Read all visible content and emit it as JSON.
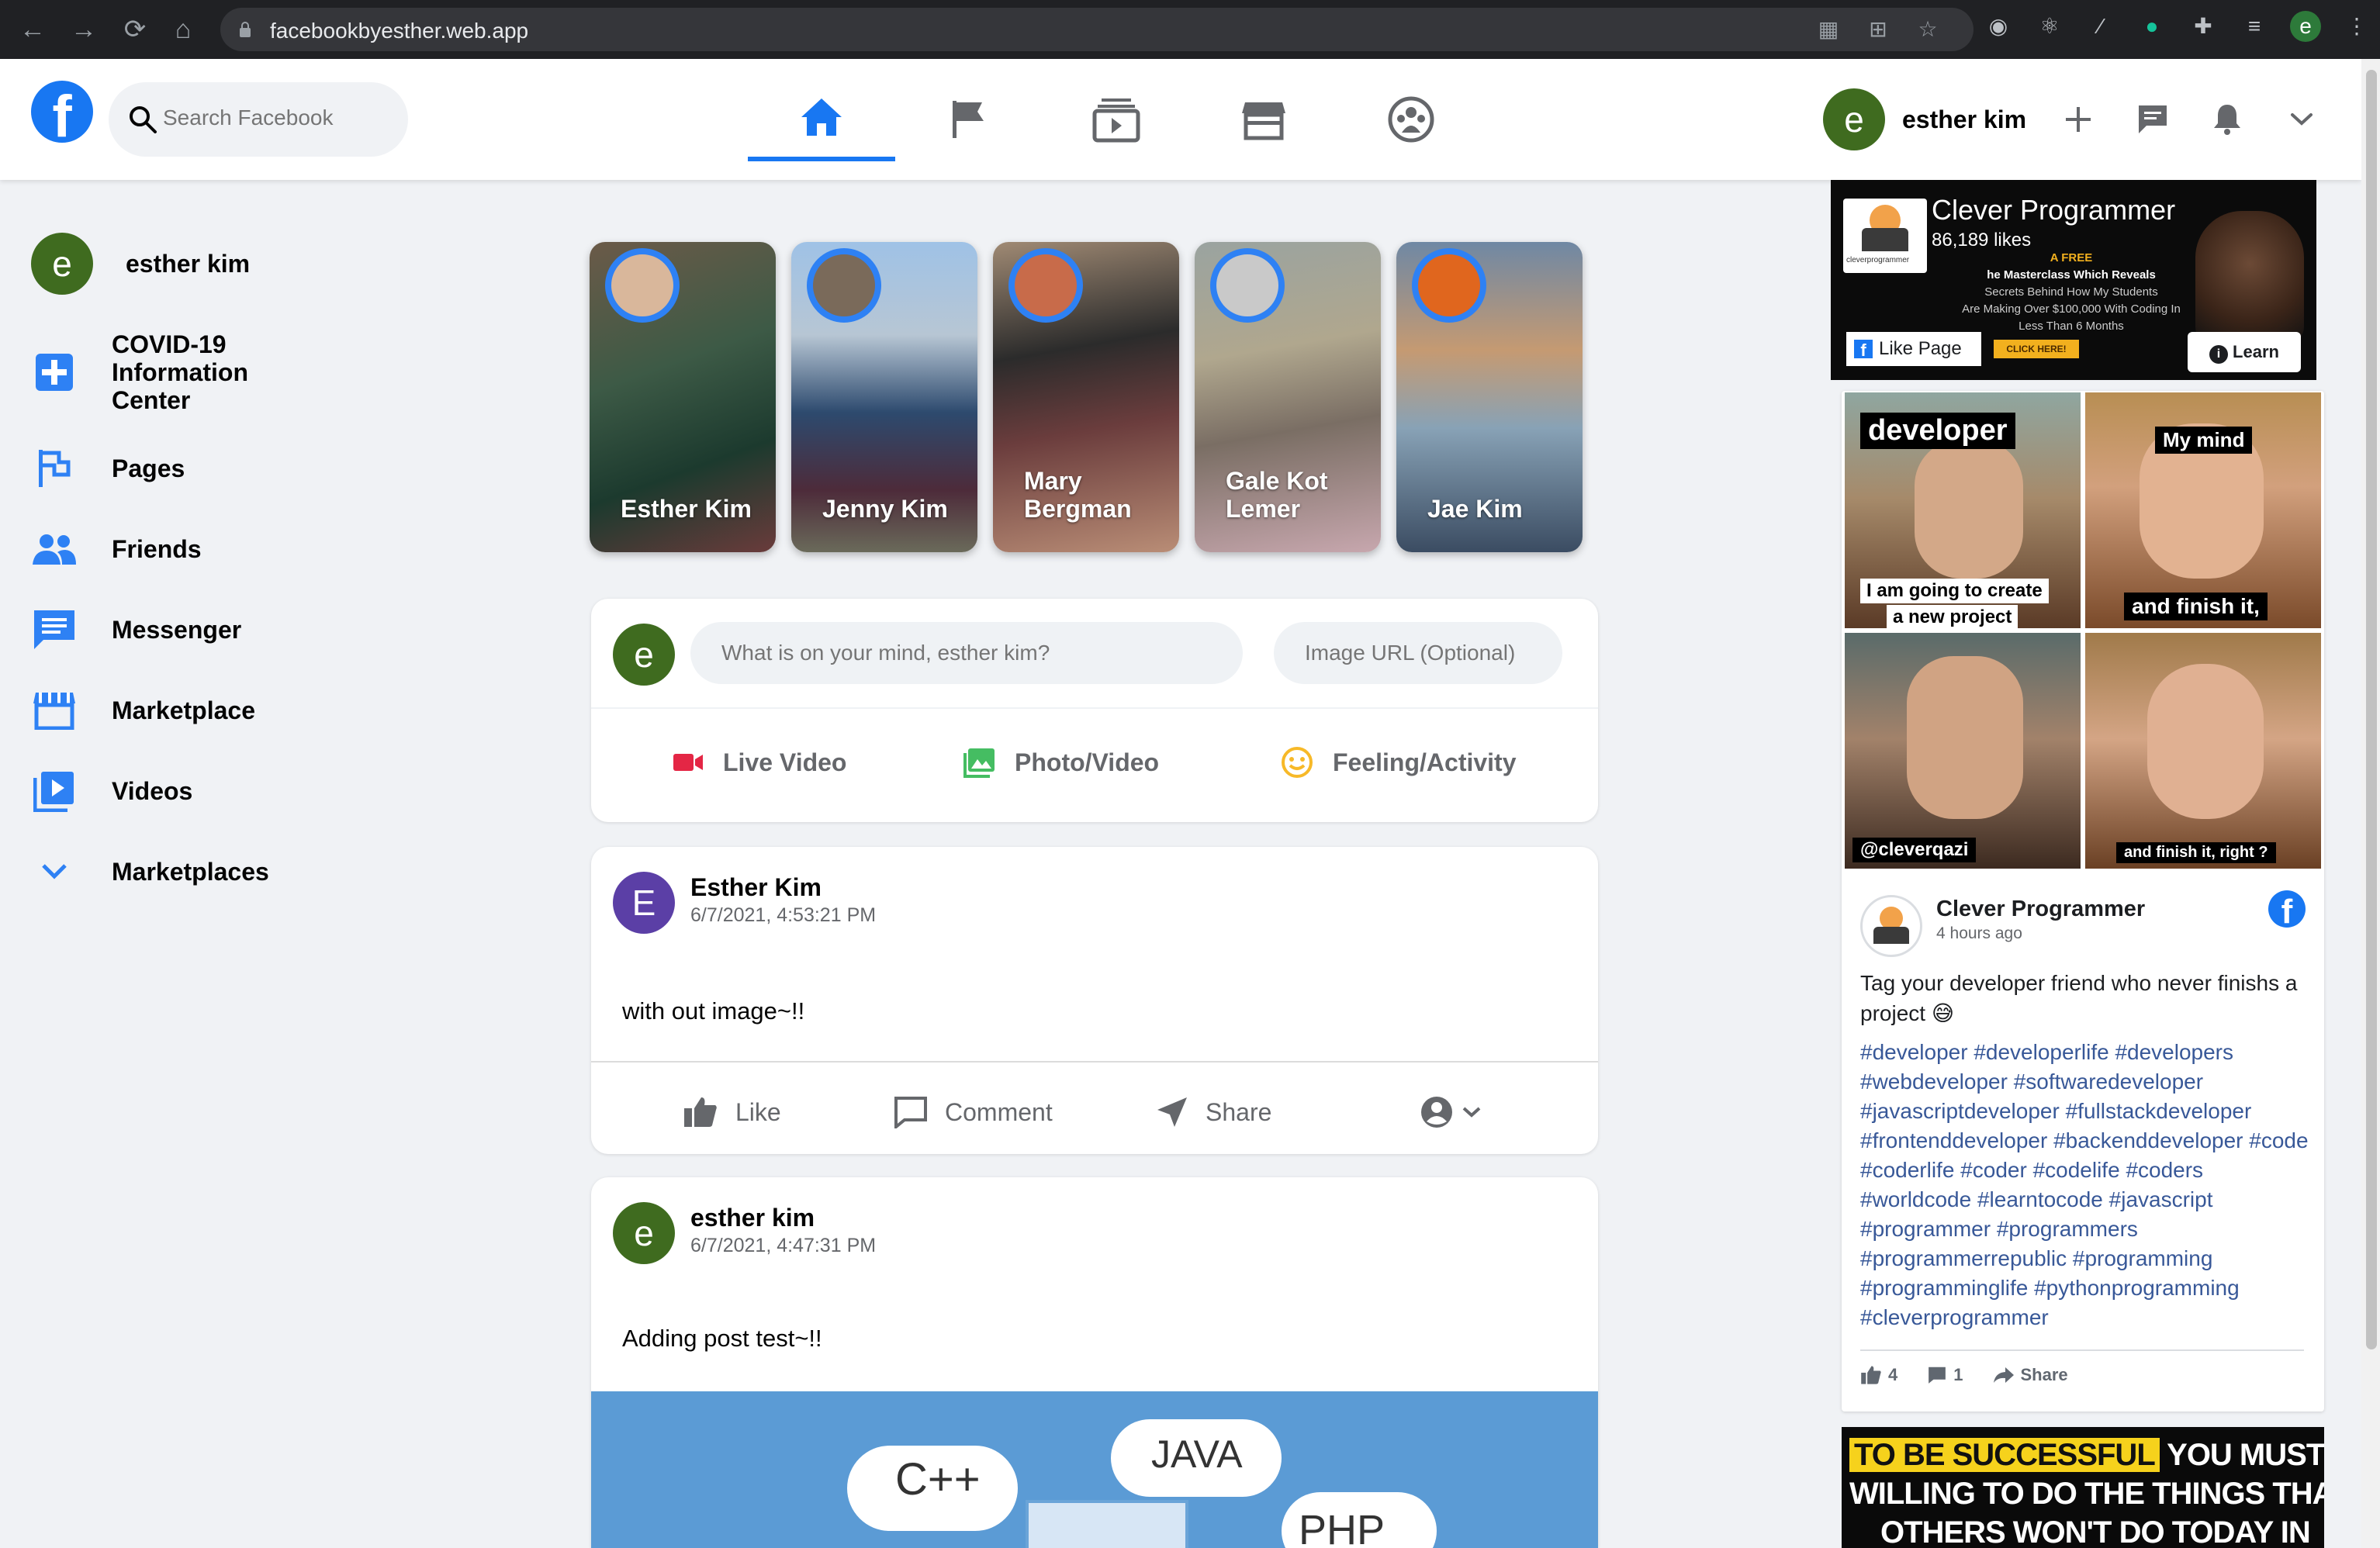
{
  "browser": {
    "url": "facebookbyesther.web.app",
    "profile_initial": "e"
  },
  "header": {
    "search_placeholder": "Search Facebook",
    "user_name": "esther kim",
    "user_initial": "e",
    "nav_tabs": [
      "home",
      "pages",
      "watch",
      "marketplace",
      "groups"
    ],
    "active_tab": "home",
    "accent": "#1877f2"
  },
  "sidebar": {
    "user_name": "esther kim",
    "user_initial": "e",
    "items": [
      {
        "label": "COVID-19 Information Center",
        "icon": "plus-cross-icon"
      },
      {
        "label": "Pages",
        "icon": "flag-icon"
      },
      {
        "label": "Friends",
        "icon": "people-icon"
      },
      {
        "label": "Messenger",
        "icon": "chat-icon"
      },
      {
        "label": "Marketplace",
        "icon": "storefront-icon"
      },
      {
        "label": "Videos",
        "icon": "video-library-icon"
      },
      {
        "label": "Marketplaces",
        "icon": "chevron-down-icon"
      }
    ]
  },
  "stories": [
    {
      "name": "Esther Kim"
    },
    {
      "name": "Jenny Kim"
    },
    {
      "name": "Mary Bergman"
    },
    {
      "name": "Gale Kot Lemer"
    },
    {
      "name": "Jae Kim"
    }
  ],
  "composer": {
    "avatar_initial": "e",
    "message_placeholder": "What is on your mind, esther kim?",
    "image_placeholder": "Image URL (Optional)",
    "actions": {
      "live": "Live Video",
      "photo": "Photo/Video",
      "feeling": "Feeling/Activity"
    }
  },
  "posts": [
    {
      "author": "Esther Kim",
      "initial": "E",
      "timestamp": "6/7/2021, 4:53:21 PM",
      "message": "with out image~!!",
      "avatar_color": "#5b3fa6"
    },
    {
      "author": "esther kim",
      "initial": "e",
      "timestamp": "6/7/2021, 4:47:31 PM",
      "message": "Adding post test~!!",
      "avatar_color": "#3f6b1f",
      "image_words": [
        "C++",
        "JAVA",
        "PHP"
      ]
    }
  ],
  "post_actions": {
    "like": "Like",
    "comment": "Comment",
    "share": "Share"
  },
  "ads": {
    "ad1": {
      "page_name": "Clever Programmer",
      "likes": "86,189 likes",
      "line1": "A FREE",
      "line2": "he Masterclass Which Reveals",
      "line3": "Secrets Behind How My Students",
      "line4": "Are Making Over $100,000 With Coding In",
      "line5": "Less Than 6 Months",
      "logo_text": "cleverprogrammer",
      "like_page": "Like Page",
      "cta": "CLICK HERE!",
      "learn_more": "Learn More"
    },
    "ad2": {
      "meme": {
        "tag_developer": "developer",
        "tag_mind": "My mind",
        "text_create": "I am going to create",
        "text_project": "a new project",
        "text_finish": "and finish it,",
        "handle": "@cleverqazi",
        "text_finish_q": "and finish it, right ?"
      },
      "page_name": "Clever Programmer",
      "time": "4 hours ago",
      "body": "Tag your developer friend who never finishs a project 😅",
      "hashtags": "#developer #developerlife #developers #webdeveloper #softwaredeveloper #javascriptdeveloper #fullstackdeveloper #frontenddeveloper #backenddeveloper #code #coderlife #coder #codelife #coders #worldcode #learntocode #javascript #programmer #programmers #programmerrepublic #programming #programminglife #pythonprogramming #cleverprogrammer",
      "likes": "4",
      "comments": "1",
      "share": "Share"
    },
    "ad3": {
      "highlight": "TO BE SUCCESSFUL",
      "line1_rest": "YOU MUST BE",
      "line2": "WILLING TO DO THE THINGS THAT",
      "line3": "OTHERS WON'T DO TODAY IN"
    }
  }
}
